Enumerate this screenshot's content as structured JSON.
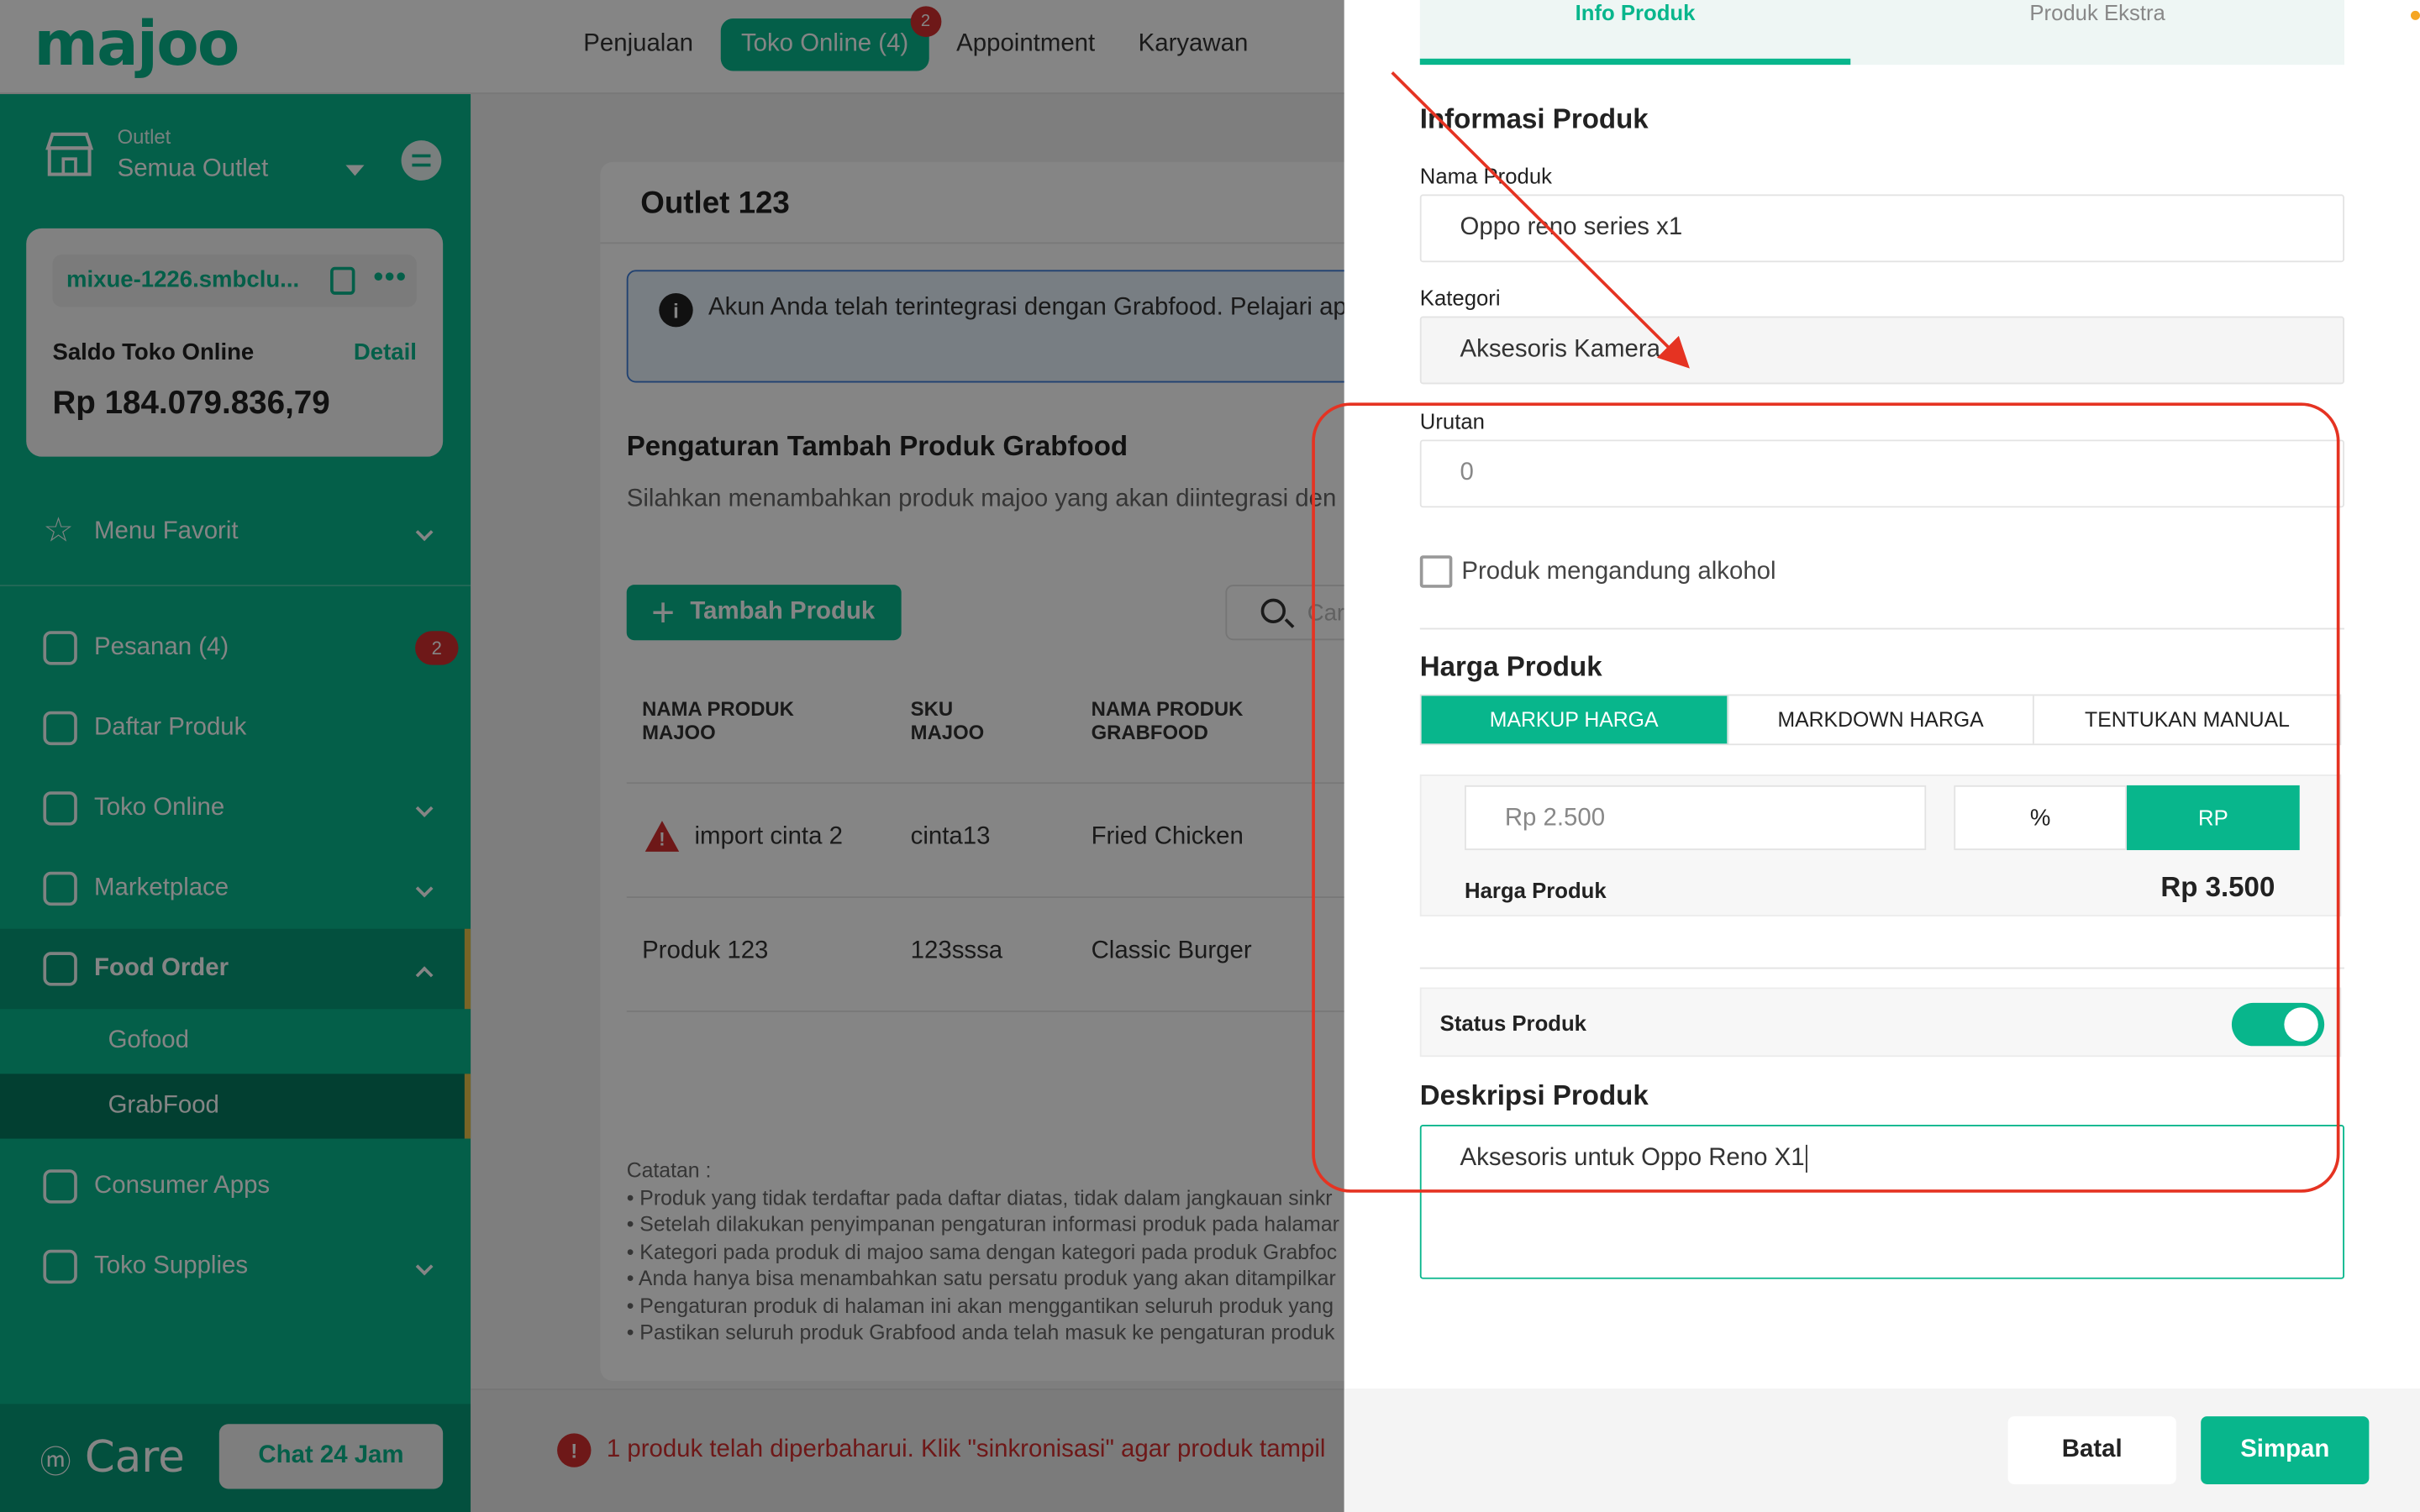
{
  "topbar": {
    "logo": "majoo",
    "nav": [
      {
        "label": "Penjualan"
      },
      {
        "label": "Toko Online (4)",
        "badge": "2"
      },
      {
        "label": "Appointment"
      },
      {
        "label": "Karyawan"
      }
    ]
  },
  "sidebar": {
    "outlet_label": "Outlet",
    "outlet_value": "Semua Outlet",
    "store_name": "mixue-1226.smbclu...",
    "saldo_label": "Saldo Toko Online",
    "saldo_detail": "Detail",
    "saldo_value": "Rp 184.079.836,79",
    "menu": [
      {
        "label": "Menu Favorit"
      },
      {
        "label": "Pesanan (4)",
        "badge": "2"
      },
      {
        "label": "Daftar Produk"
      },
      {
        "label": "Toko Online"
      },
      {
        "label": "Marketplace"
      },
      {
        "label": "Food Order"
      },
      {
        "label": "Consumer Apps"
      },
      {
        "label": "Toko Supplies"
      }
    ],
    "submenu": [
      {
        "label": "Gofood"
      },
      {
        "label": "GrabFood"
      }
    ],
    "care_logo": "Care",
    "chat_button": "Chat 24 Jam"
  },
  "main": {
    "outlet_title": "Outlet 123",
    "info_text": "Akun Anda telah terintegrasi dengan Grabfood. Pelajari ap",
    "section_title": "Pengaturan Tambah Produk Grabfood",
    "section_sub": "Silahkan menambahkan produk majoo yang akan diintegrasi den",
    "add_button": "Tambah Produk",
    "search_placeholder": "Car",
    "columns": [
      "NAMA PRODUK MAJOO",
      "SKU MAJOO",
      "NAMA PRODUK GRABFOOD"
    ],
    "rows": [
      {
        "name": "import cinta 2",
        "sku": "cinta13",
        "grab": "Fried Chicken",
        "warning": true
      },
      {
        "name": "Produk 123",
        "sku": "123sssa",
        "grab": "Classic Burger",
        "warning": false
      }
    ],
    "notes_title": "Catatan :",
    "notes": [
      "Produk yang tidak terdaftar pada daftar diatas, tidak dalam jangkauan sinkr",
      "Setelah dilakukan penyimpanan pengaturan informasi produk pada halamar",
      "Kategori pada produk di majoo sama dengan kategori pada produk Grabfoc",
      "Anda hanya bisa menambahkan satu persatu produk yang akan ditampilkar",
      "Pengaturan produk di halaman ini akan menggantikan seluruh produk yang",
      "Pastikan seluruh produk Grabfood anda telah masuk ke pengaturan produk"
    ],
    "error_text": "1 produk telah diperbaharui. Klik \"sinkronisasi\" agar produk tampil"
  },
  "drawer": {
    "tabs": [
      "Info Produk",
      "Produk Ekstra"
    ],
    "title": "Informasi Produk",
    "nama_label": "Nama Produk",
    "nama_value": "Oppo reno series x1",
    "kategori_label": "Kategori",
    "kategori_value": "Aksesoris Kamera",
    "urutan_label": "Urutan",
    "urutan_value": "0",
    "alkohol_label": "Produk mengandung alkohol",
    "harga_title": "Harga Produk",
    "price_modes": [
      "MARKUP HARGA",
      "MARKDOWN HARGA",
      "TENTUKAN MANUAL"
    ],
    "markup_value": "Rp 2.500",
    "unit_pct": "%",
    "unit_rp": "RP",
    "harga_label": "Harga Produk",
    "harga_value": "Rp 3.500",
    "status_label": "Status Produk",
    "status_on": true,
    "deskripsi_title": "Deskripsi Produk",
    "deskripsi_value": "Aksesoris untuk Oppo Reno X1",
    "cancel_button": "Batal",
    "save_button": "Simpan"
  },
  "colors": {
    "brand": "#08b68c",
    "danger": "#d32f2f",
    "annotation": "#e53322"
  }
}
